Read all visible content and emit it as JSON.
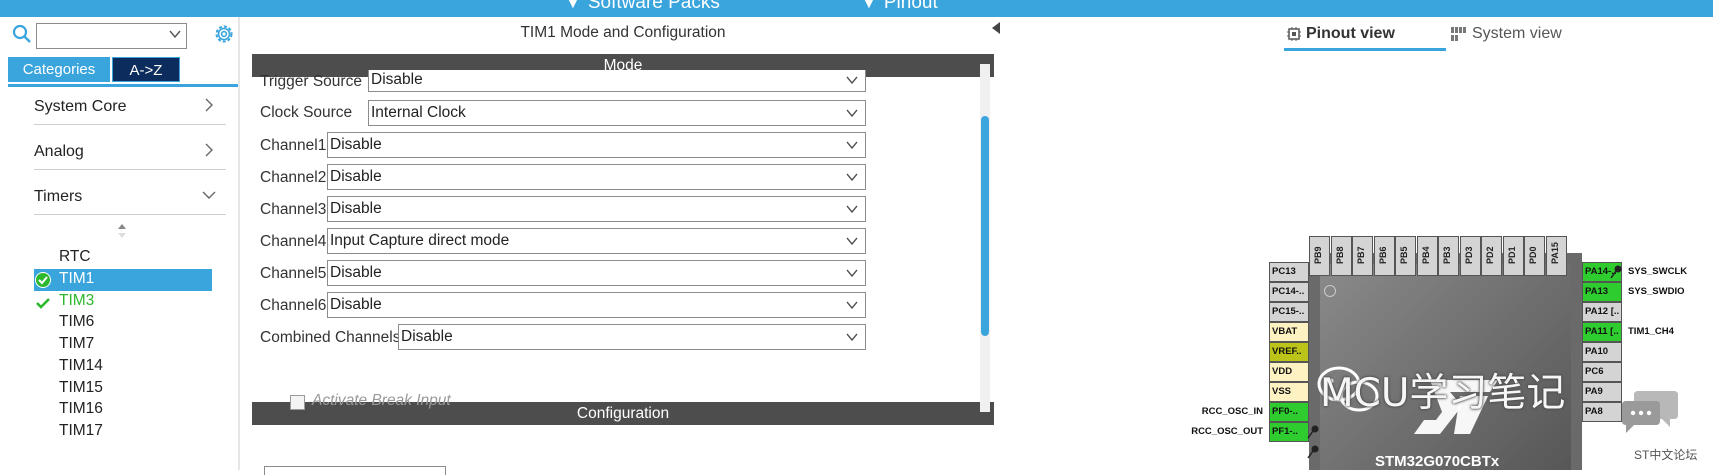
{
  "topbar": {
    "software_packs": "Software Packs",
    "pinout": "Pinout",
    "color": "#3aa4dc"
  },
  "left": {
    "search": {
      "value": "",
      "placeholder": ""
    },
    "tabs": {
      "categories": "Categories",
      "az": "A->Z"
    },
    "categories": [
      {
        "label": "System Core",
        "expanded": false
      },
      {
        "label": "Analog",
        "expanded": false
      },
      {
        "label": "Timers",
        "expanded": true
      }
    ],
    "timers": [
      {
        "label": "RTC",
        "state": "none"
      },
      {
        "label": "TIM1",
        "state": "selected-configured"
      },
      {
        "label": "TIM3",
        "state": "configured"
      },
      {
        "label": "TIM6",
        "state": "none"
      },
      {
        "label": "TIM7",
        "state": "none"
      },
      {
        "label": "TIM14",
        "state": "none"
      },
      {
        "label": "TIM15",
        "state": "none"
      },
      {
        "label": "TIM16",
        "state": "none"
      },
      {
        "label": "TIM17",
        "state": "none"
      }
    ]
  },
  "mid": {
    "title": "TIM1 Mode and Configuration",
    "mode_header": "Mode",
    "config_header": "Configuration",
    "fields": [
      {
        "label": "Trigger Source",
        "value": "Disable"
      },
      {
        "label": "Clock Source",
        "value": "Internal Clock"
      },
      {
        "label": "Channel1",
        "value": "Disable"
      },
      {
        "label": "Channel2",
        "value": "Disable"
      },
      {
        "label": "Channel3",
        "value": "Disable"
      },
      {
        "label": "Channel4",
        "value": "Input Capture direct mode"
      },
      {
        "label": "Channel5",
        "value": "Disable"
      },
      {
        "label": "Channel6",
        "value": "Disable"
      },
      {
        "label": "Combined Channels",
        "value": "Disable"
      }
    ],
    "break_input": {
      "label": "Activate Break Input",
      "checked": false,
      "enabled": false
    }
  },
  "right": {
    "tabs": {
      "pinout_view": "Pinout view",
      "system_view": "System view"
    },
    "chip_name": "STM32G070CBTx",
    "top_pins": [
      "PB9",
      "PB8",
      "PB7",
      "PB6",
      "PB5",
      "PB4",
      "PB3",
      "PD3",
      "PD2",
      "PD1",
      "PD0",
      "PA15"
    ],
    "left_pins": [
      {
        "name": "PC13",
        "color": "#d4d4d4",
        "label": ""
      },
      {
        "name": "PC14-..",
        "color": "#d4d4d4",
        "label": ""
      },
      {
        "name": "PC15-..",
        "color": "#d4d4d4",
        "label": ""
      },
      {
        "name": "VBAT",
        "color": "#fff2c2",
        "label": ""
      },
      {
        "name": "VREF..",
        "color": "#bcc41a",
        "label": ""
      },
      {
        "name": "VDD",
        "color": "#fff2c2",
        "label": ""
      },
      {
        "name": "VSS",
        "color": "#fff2c2",
        "label": ""
      },
      {
        "name": "PF0-..",
        "color": "#2ecc2e",
        "label": "RCC_OSC_IN"
      },
      {
        "name": "PF1-..",
        "color": "#2ecc2e",
        "label": "RCC_OSC_OUT"
      }
    ],
    "right_pins": [
      {
        "name": "PA14-..",
        "color": "#2ecc2e",
        "label": "SYS_SWCLK"
      },
      {
        "name": "PA13",
        "color": "#2ecc2e",
        "label": "SYS_SWDIO"
      },
      {
        "name": "PA12 [..",
        "color": "#d4d4d4",
        "label": ""
      },
      {
        "name": "PA11 [..",
        "color": "#2ecc2e",
        "label": "TIM1_CH4"
      },
      {
        "name": "PA10",
        "color": "#d4d4d4",
        "label": ""
      },
      {
        "name": "PC6",
        "color": "#d4d4d4",
        "label": ""
      },
      {
        "name": "PA9",
        "color": "#d4d4d4",
        "label": ""
      },
      {
        "name": "PA8",
        "color": "#d4d4d4",
        "label": ""
      }
    ]
  },
  "watermark": {
    "text": "MCU学习笔记",
    "forum": "ST中文论坛"
  }
}
